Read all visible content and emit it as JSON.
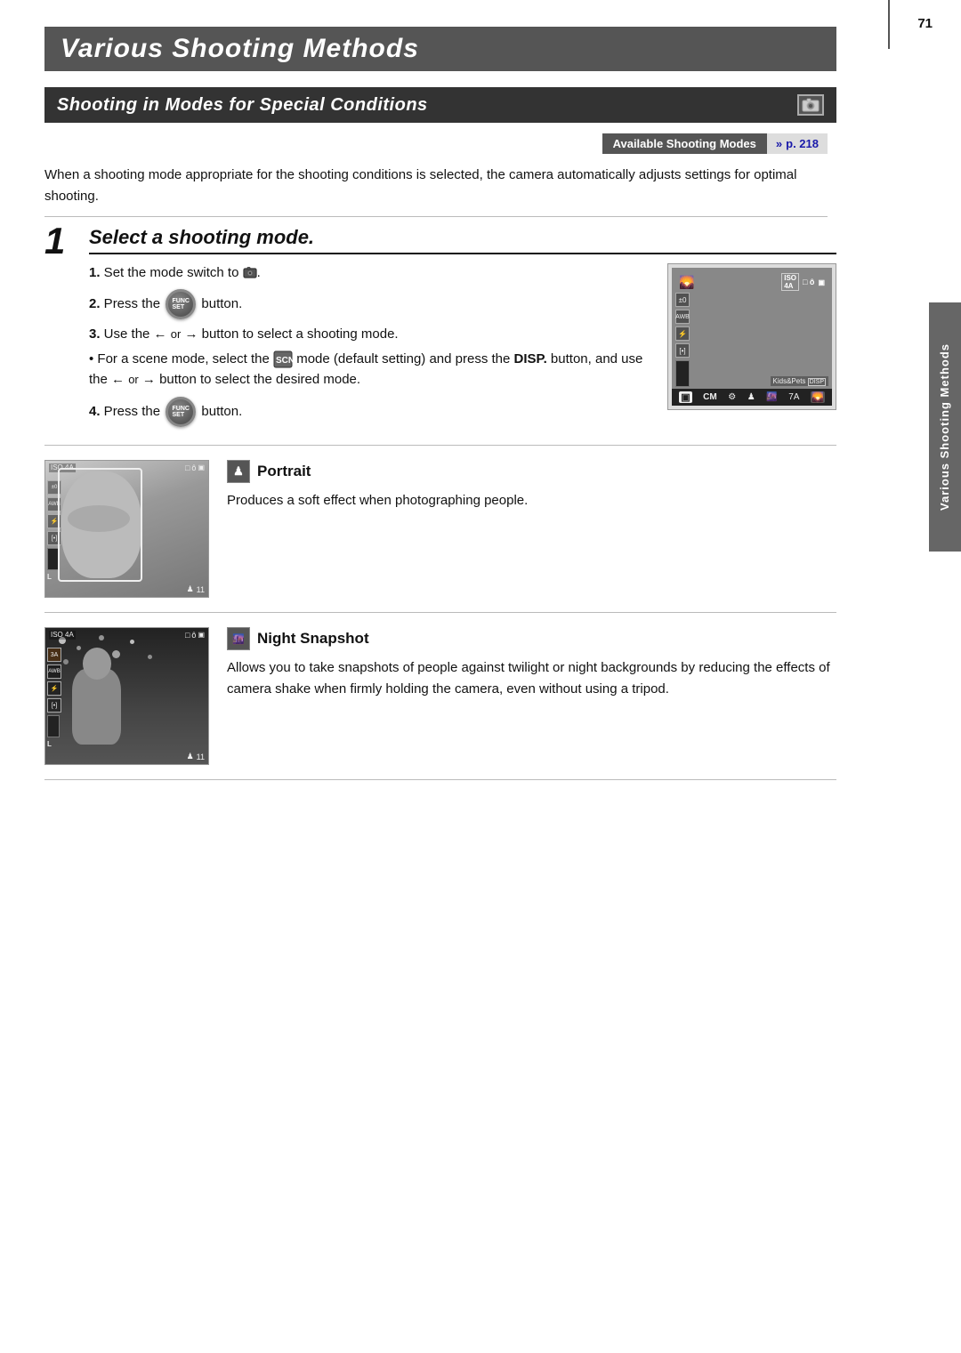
{
  "page": {
    "number": "71",
    "title": "Various Shooting Methods",
    "side_tab": "Various Shooting Methods",
    "section_header": "Shooting in Modes for Special Conditions",
    "modes_bar_label": "Available Shooting Modes",
    "modes_bar_link": "p. 218",
    "intro_text": "When a shooting mode appropriate for the shooting conditions is selected, the camera automatically adjusts settings for optimal shooting.",
    "step1_number": "1",
    "step1_title": "Select a shooting mode.",
    "instructions": [
      {
        "num": "1.",
        "text": "Set the mode switch to ▣."
      },
      {
        "num": "2.",
        "text": "Press the  FUNC  button."
      },
      {
        "num": "3.",
        "text": "Use the ← or → button to select a shooting mode."
      },
      {
        "num": "4.",
        "text": "Press the  FUNC  button."
      }
    ],
    "bullet_note": "• For a scene mode, select the  SCN  mode (default setting) and press the DISP. button, and use the ← or → button to select the desired mode.",
    "portrait": {
      "title": "Portrait",
      "icon_symbol": "♟",
      "description": "Produces a soft effect when photographing people."
    },
    "night_snapshot": {
      "title": "Night Snapshot",
      "icon_symbol": "🌃",
      "description": "Allows you to take snapshots of people against twilight or night backgrounds by reducing the effects of camera shake when firmly holding the camera, even without using a tripod."
    },
    "cam_display": {
      "top_icons": "ISO 4A  □ ô",
      "exposure": "±0",
      "wb": "AWB",
      "flash": "⚡OFF",
      "kids_pets": "Kids&Pets DISP",
      "modes": [
        "▣",
        "CM",
        "⚙",
        "♟",
        "🌆",
        "7A",
        "SCN"
      ]
    }
  }
}
